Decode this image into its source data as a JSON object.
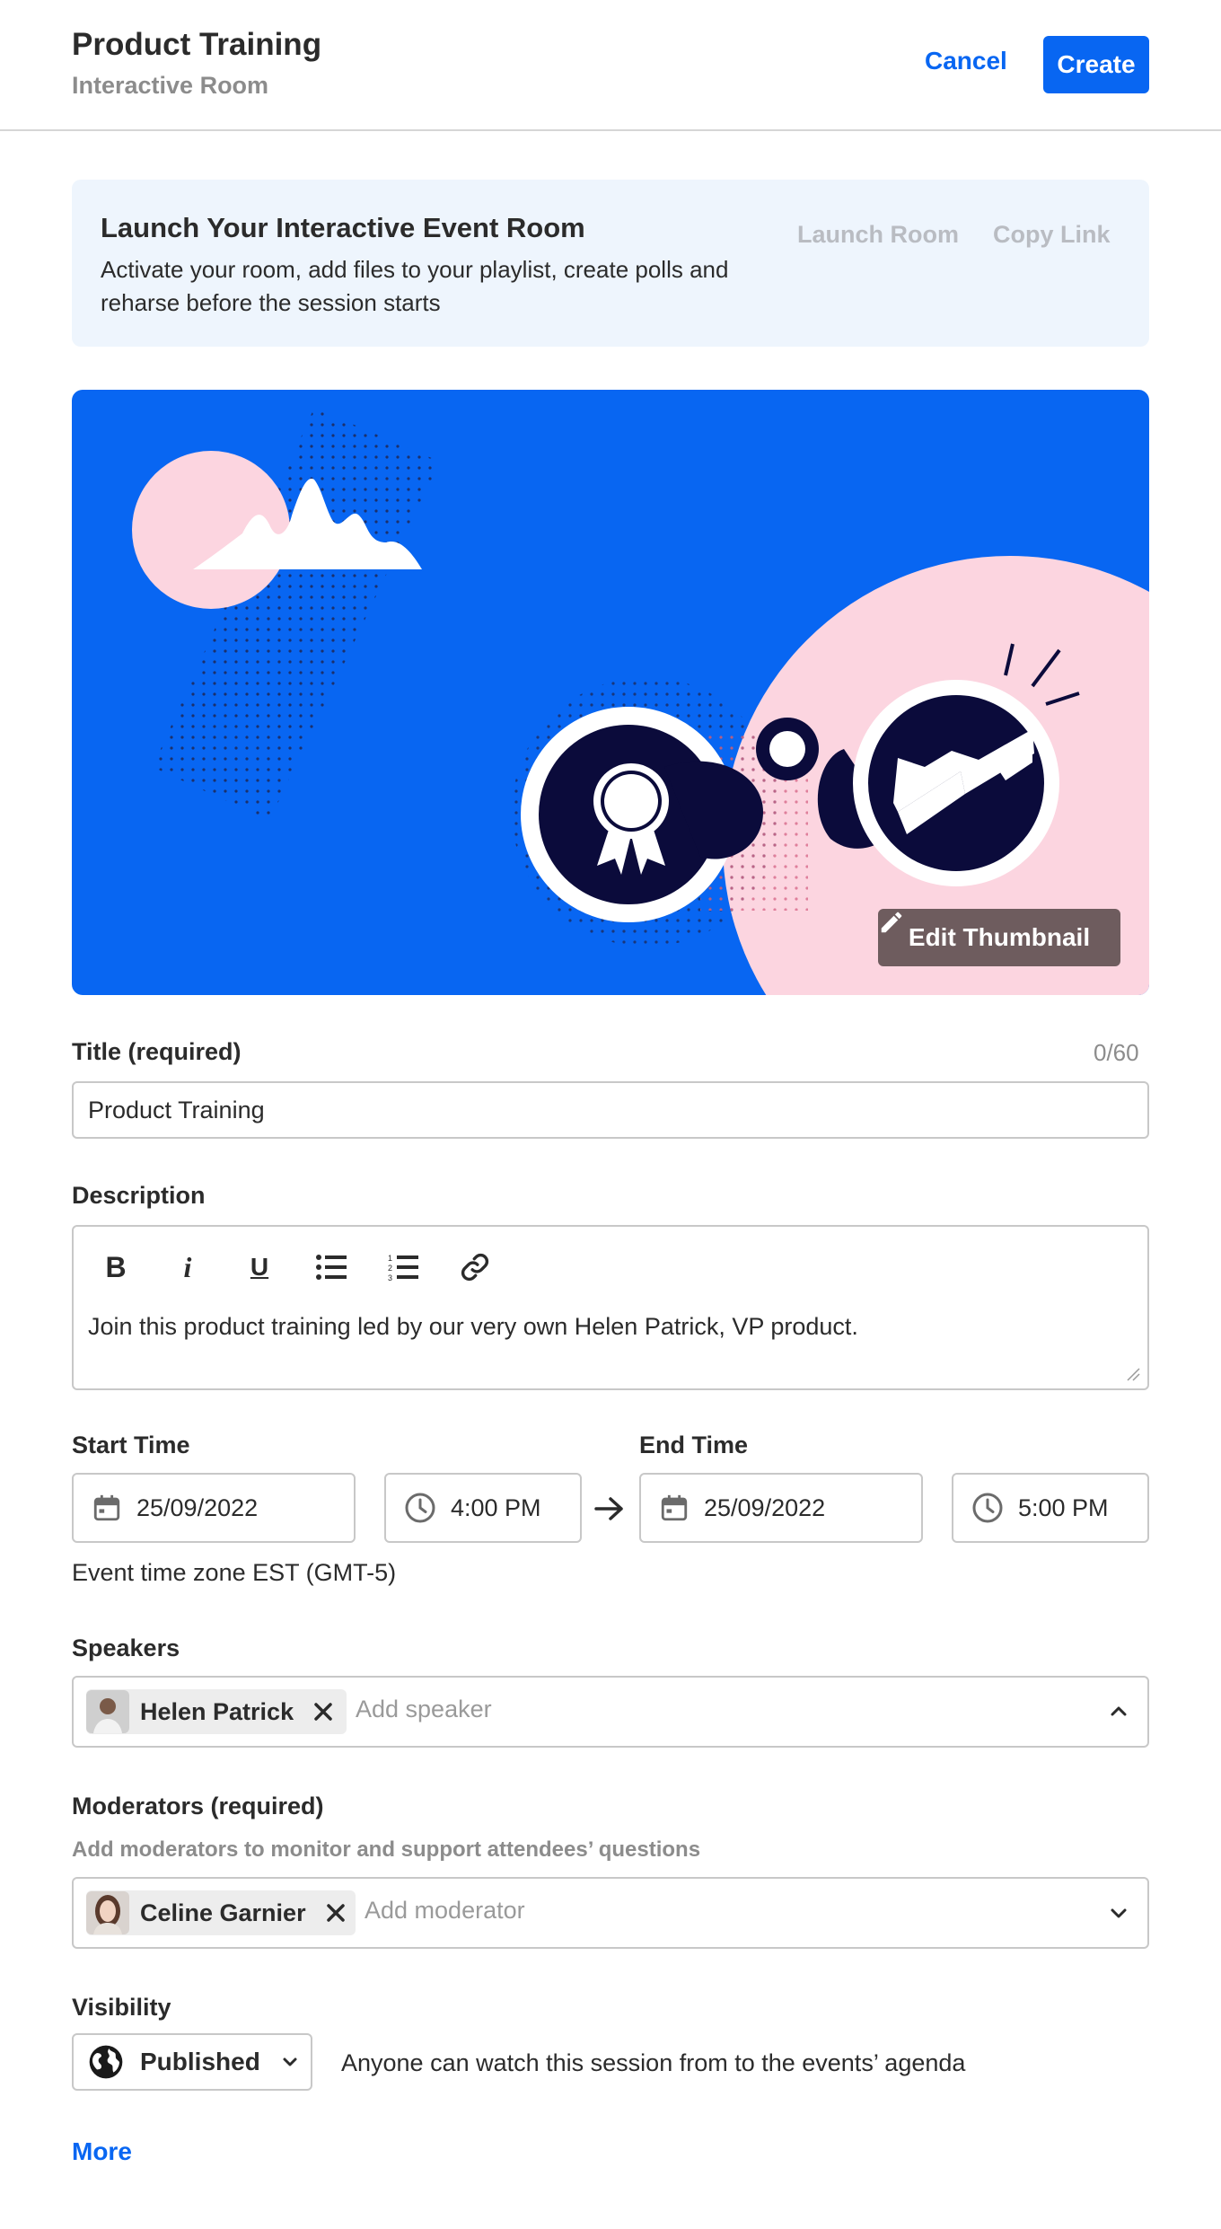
{
  "header": {
    "title": "Product Training",
    "subtitle": "Interactive Room",
    "cancel_label": "Cancel",
    "create_label": "Create"
  },
  "banner": {
    "title": "Launch Your Interactive Event Room",
    "text": "Activate your room, add files to your playlist, create polls and reharse before the session starts",
    "launch_label": "Launch Room",
    "copy_label": "Copy Link"
  },
  "thumbnail": {
    "edit_label": "Edit Thumbnail",
    "icon": "pencil-icon"
  },
  "title_field": {
    "label": "Title (required)",
    "counter": "0/60",
    "value": "Product Training"
  },
  "description": {
    "label": "Description",
    "toolbar": [
      "bold-icon",
      "italic-icon",
      "underline-icon",
      "bullet-list-icon",
      "numbered-list-icon",
      "link-icon"
    ],
    "value": "Join this product training led by our very own Helen Patrick, VP product."
  },
  "time": {
    "start_label": "Start Time",
    "end_label": "End Time",
    "start_date": "25/09/2022",
    "start_time": "4:00 PM",
    "end_date": "25/09/2022",
    "end_time": "5:00 PM",
    "timezone": "Event time zone EST (GMT-5)"
  },
  "speakers": {
    "label": "Speakers",
    "selected": "Helen Patrick",
    "placeholder": "Add speaker"
  },
  "moderators": {
    "label": "Moderators (required)",
    "hint": "Add moderators to monitor and support attendees’ questions",
    "selected": "Celine Garnier",
    "placeholder": "Add moderator"
  },
  "visibility": {
    "label": "Visibility",
    "value": "Published",
    "description": "Anyone can watch this session from to the events’ agenda"
  },
  "more_label": "More",
  "colors": {
    "accent": "#0866f2",
    "thumb_pink": "#fcd5e0",
    "thumb_navy": "#0b0b3b"
  }
}
